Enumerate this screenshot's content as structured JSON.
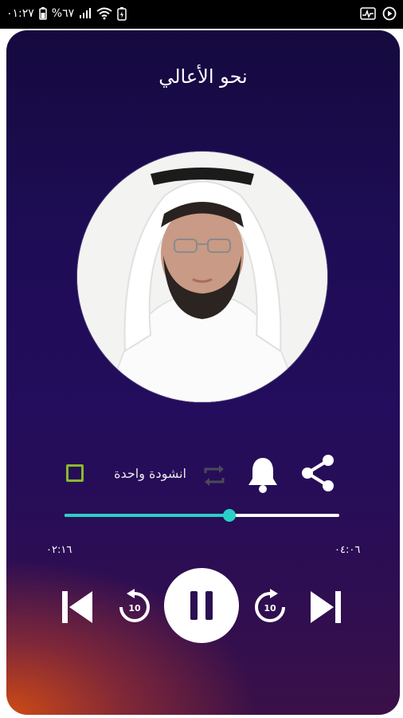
{
  "status_bar": {
    "time": "٠١:٢٧",
    "battery": "%٦٧"
  },
  "player": {
    "title": "نحو الأعالي",
    "single_track_label": "انشودة واحدة",
    "elapsed": "٠٢:١٦",
    "duration": "٠٤:٠٦",
    "progress": 0.6,
    "rewind_seconds": "10",
    "forward_seconds": "10",
    "single_track_checked": false
  },
  "colors": {
    "accent": "#2ad0c8",
    "checkbox": "#8cb82a",
    "background_top": "#150a3f",
    "background_glow": "#d64e12"
  }
}
